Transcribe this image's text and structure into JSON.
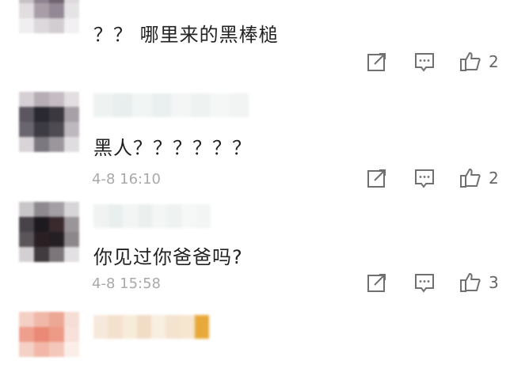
{
  "comments": [
    {
      "text": "？？ 哪里来的黑棒槌",
      "time": "",
      "likes": "2",
      "avatar_colors": [
        "#d9d3d8",
        "#c8bcc6",
        "#b9aab5",
        "#e6e3e6",
        "#c7c0c5",
        "#8e8290",
        "#6f6370",
        "#ddd9dd",
        "#e1dde0",
        "#a99ea8",
        "#938895",
        "#e6e3e6",
        "#f0eef0",
        "#dcd8db",
        "#d2cdd1",
        "#f2f0f2"
      ],
      "name_colors": [
        "#eef1f3",
        "#e8ecef",
        "#f0f2f4",
        "#e9edf0",
        "#f2f4f5",
        "#edf0f2",
        "#f4f5f6",
        "#f1f3f4"
      ]
    },
    {
      "text": "黑人？？？？？？",
      "time": "4-8 16:10",
      "likes": "2",
      "avatar_colors": [
        "#d6d0d4",
        "#b7aeb5",
        "#c4bcc2",
        "#e2dee1",
        "#5b5660",
        "#2a2830",
        "#3b3840",
        "#a7a0a6",
        "#6a6670",
        "#3c3a42",
        "#4e4b53",
        "#bdb8bd",
        "#d8d4d8",
        "#7c7880",
        "#9a969c",
        "#e0dde0"
      ],
      "name_colors": [
        "#eef3f2",
        "#e7eeed",
        "#f1f5f4",
        "#e9f0ef",
        "#f3f6f5",
        "#eef2f1",
        "#f5f7f6",
        "#f2f4f3"
      ]
    },
    {
      "text": "你见过你爸爸吗?",
      "time": "4-8 15:58",
      "likes": "3",
      "avatar_colors": [
        "#c9c6c9",
        "#8f8a90",
        "#a39fa4",
        "#d8d5d8",
        "#474349",
        "#1d1a1f",
        "#3a2a2e",
        "#9a9599",
        "#5a5559",
        "#2a2024",
        "#241f23",
        "#8c878b",
        "#d3d0d3",
        "#413a3e",
        "#7c767a",
        "#e3e0e3"
      ],
      "name_colors": [
        "#f0f3f2",
        "#e9efee",
        "#f2f5f4",
        "#ebf0ef",
        "#f4f6f5",
        "#eef2f1",
        "#f6f7f7",
        "#f3f5f4"
      ]
    },
    {
      "avatar_colors": [
        "#f4cfc4",
        "#f0b8a9",
        "#eda795",
        "#f6ddd6",
        "#ef9f8d",
        "#ea8a76",
        "#ed9a87",
        "#f7e1da",
        "#f5d0c5",
        "#f2b7a8",
        "#f4c7bb",
        "#fbeee9",
        "#ffffff",
        "#ffffff",
        "#ffffff",
        "#ffffff"
      ],
      "name_colors": [
        "#f6e9dc",
        "#f3e0cd",
        "#f7ecd9",
        "#f1dcc6",
        "#f8efe0",
        "#f4e3cf",
        "#f6e6cf",
        "#e7a93a"
      ]
    }
  ],
  "icons": {
    "share": "share-icon",
    "comment": "comment-icon",
    "like": "thumbs-up-icon"
  },
  "colors": {
    "text": "#222222",
    "time": "#a9a9a9",
    "icon": "#707070"
  }
}
